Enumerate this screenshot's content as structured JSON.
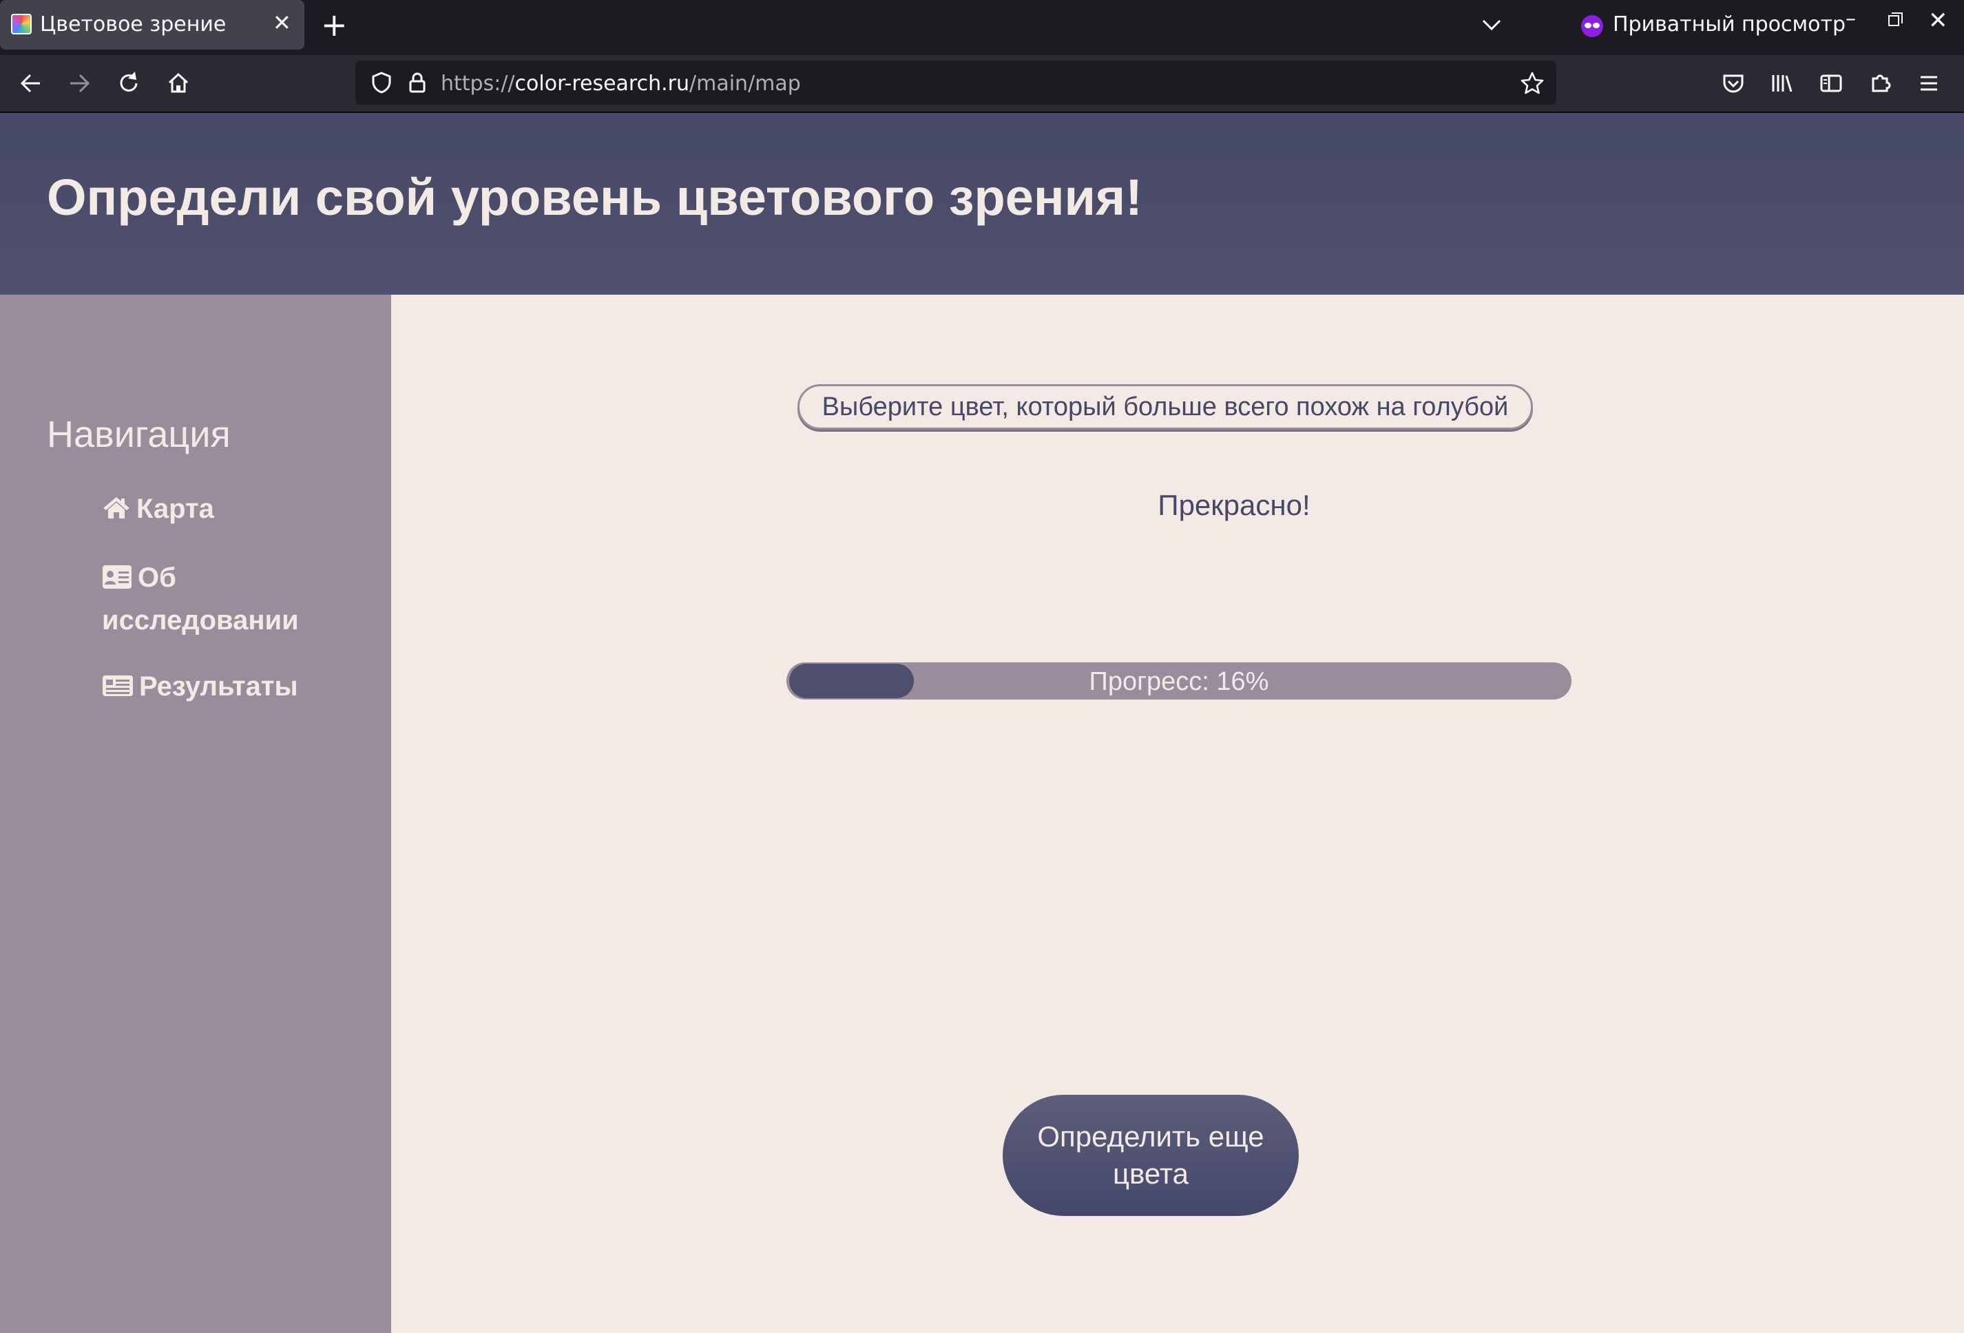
{
  "browser": {
    "tab_title": "Цветовое зрение",
    "private_label": "Приватный просмотр",
    "url_scheme": "https://",
    "url_host": "color-research.ru",
    "url_path": "/main/map"
  },
  "header": {
    "title": "Определи свой уровень цветового зрения!"
  },
  "sidebar": {
    "heading": "Навигация",
    "items": [
      {
        "label": "Карта",
        "icon": "home-icon"
      },
      {
        "label": "Об исследовании",
        "icon": "id-card-icon"
      },
      {
        "label": "Результаты",
        "icon": "newspaper-icon"
      }
    ]
  },
  "main": {
    "question": "Выберите цвет, который больше всего похож на голубой",
    "feedback": "Прекрасно!",
    "progress_label": "Прогресс: 16%",
    "progress_percent": 16,
    "more_button": "Определить еще цвета"
  },
  "colors": {
    "header_bg": "#4b4d6b",
    "sidebar_bg": "#9a8c9b",
    "page_bg": "#f3e9e5",
    "accent": "#454866"
  }
}
